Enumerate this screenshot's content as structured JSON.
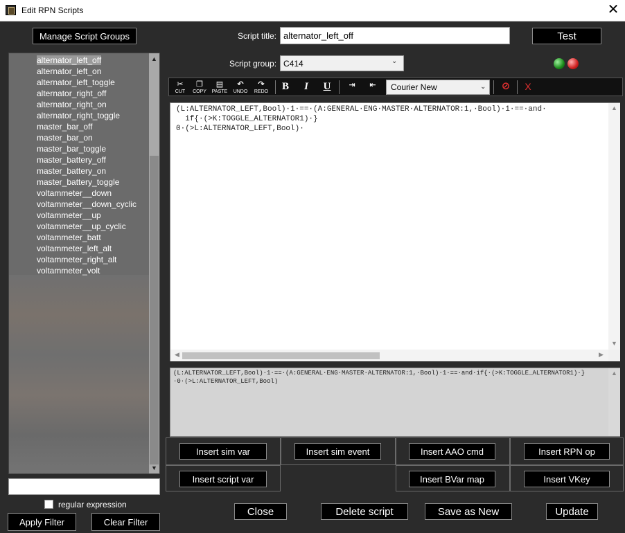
{
  "window": {
    "title": "Edit RPN Scripts",
    "close_glyph": "✕"
  },
  "left": {
    "manage_button": "Manage Script Groups",
    "scripts": [
      "alternator_left_off",
      "alternator_left_on",
      "alternator_left_toggle",
      "alternator_right_off",
      "alternator_right_on",
      "alternator_right_toggle",
      "master_bar_off",
      "master_bar_on",
      "master_bar_toggle",
      "master_battery_off",
      "master_battery_on",
      "master_battery_toggle",
      "voltammeter__down",
      "voltammeter__down_cyclic",
      "voltammeter__up",
      "voltammeter__up_cyclic",
      "voltammeter_batt",
      "voltammeter_left_alt",
      "voltammeter_right_alt",
      "voltammeter_volt"
    ],
    "selected_script": "alternator_left_off",
    "filter_value": "",
    "regex_label": "regular expression",
    "apply_filter": "Apply Filter",
    "clear_filter": "Clear Filter"
  },
  "form": {
    "title_label": "Script title:",
    "title_value": "alternator_left_off",
    "group_label": "Script group:",
    "group_value": "C414",
    "test_button": "Test"
  },
  "toolbar": {
    "cut": "CUT",
    "copy": "COPY",
    "paste": "PASTE",
    "undo": "UNDO",
    "redo": "REDO",
    "bold": "B",
    "italic": "I",
    "underline": "U",
    "font": "Courier New",
    "clear_format": "X"
  },
  "editor": {
    "line1": "(L:ALTERNATOR_LEFT,Bool)·1·==·(A:GENERAL·ENG·MASTER·ALTERNATOR:1,·Bool)·1·==·and·",
    "line2": "  if{·(>K:TOGGLE_ALTERNATOR1)·}",
    "line3": "0·(>L:ALTERNATOR_LEFT,Bool)·"
  },
  "preview": {
    "text": "(L:ALTERNATOR_LEFT,Bool)·1·==·(A:GENERAL·ENG·MASTER·ALTERNATOR:1,·Bool)·1·==·and·if{·(>K:TOGGLE_ALTERNATOR1)·}·0·(>L:ALTERNATOR_LEFT,Bool)"
  },
  "insert": {
    "sim_var": "Insert sim var",
    "sim_event": "Insert sim event",
    "aao_cmd": "Insert AAO cmd",
    "rpn_op": "Insert RPN op",
    "script_var": "Insert script var",
    "bvar_map": "Insert BVar map",
    "vkey": "Insert VKey"
  },
  "actions": {
    "close": "Close",
    "delete": "Delete script",
    "save_as_new": "Save as New",
    "update": "Update"
  },
  "colors": {
    "background": "#2b2b2b",
    "list_bg": "#6b6b6b",
    "led_green": "#1a8a1a",
    "led_red": "#d02020"
  }
}
